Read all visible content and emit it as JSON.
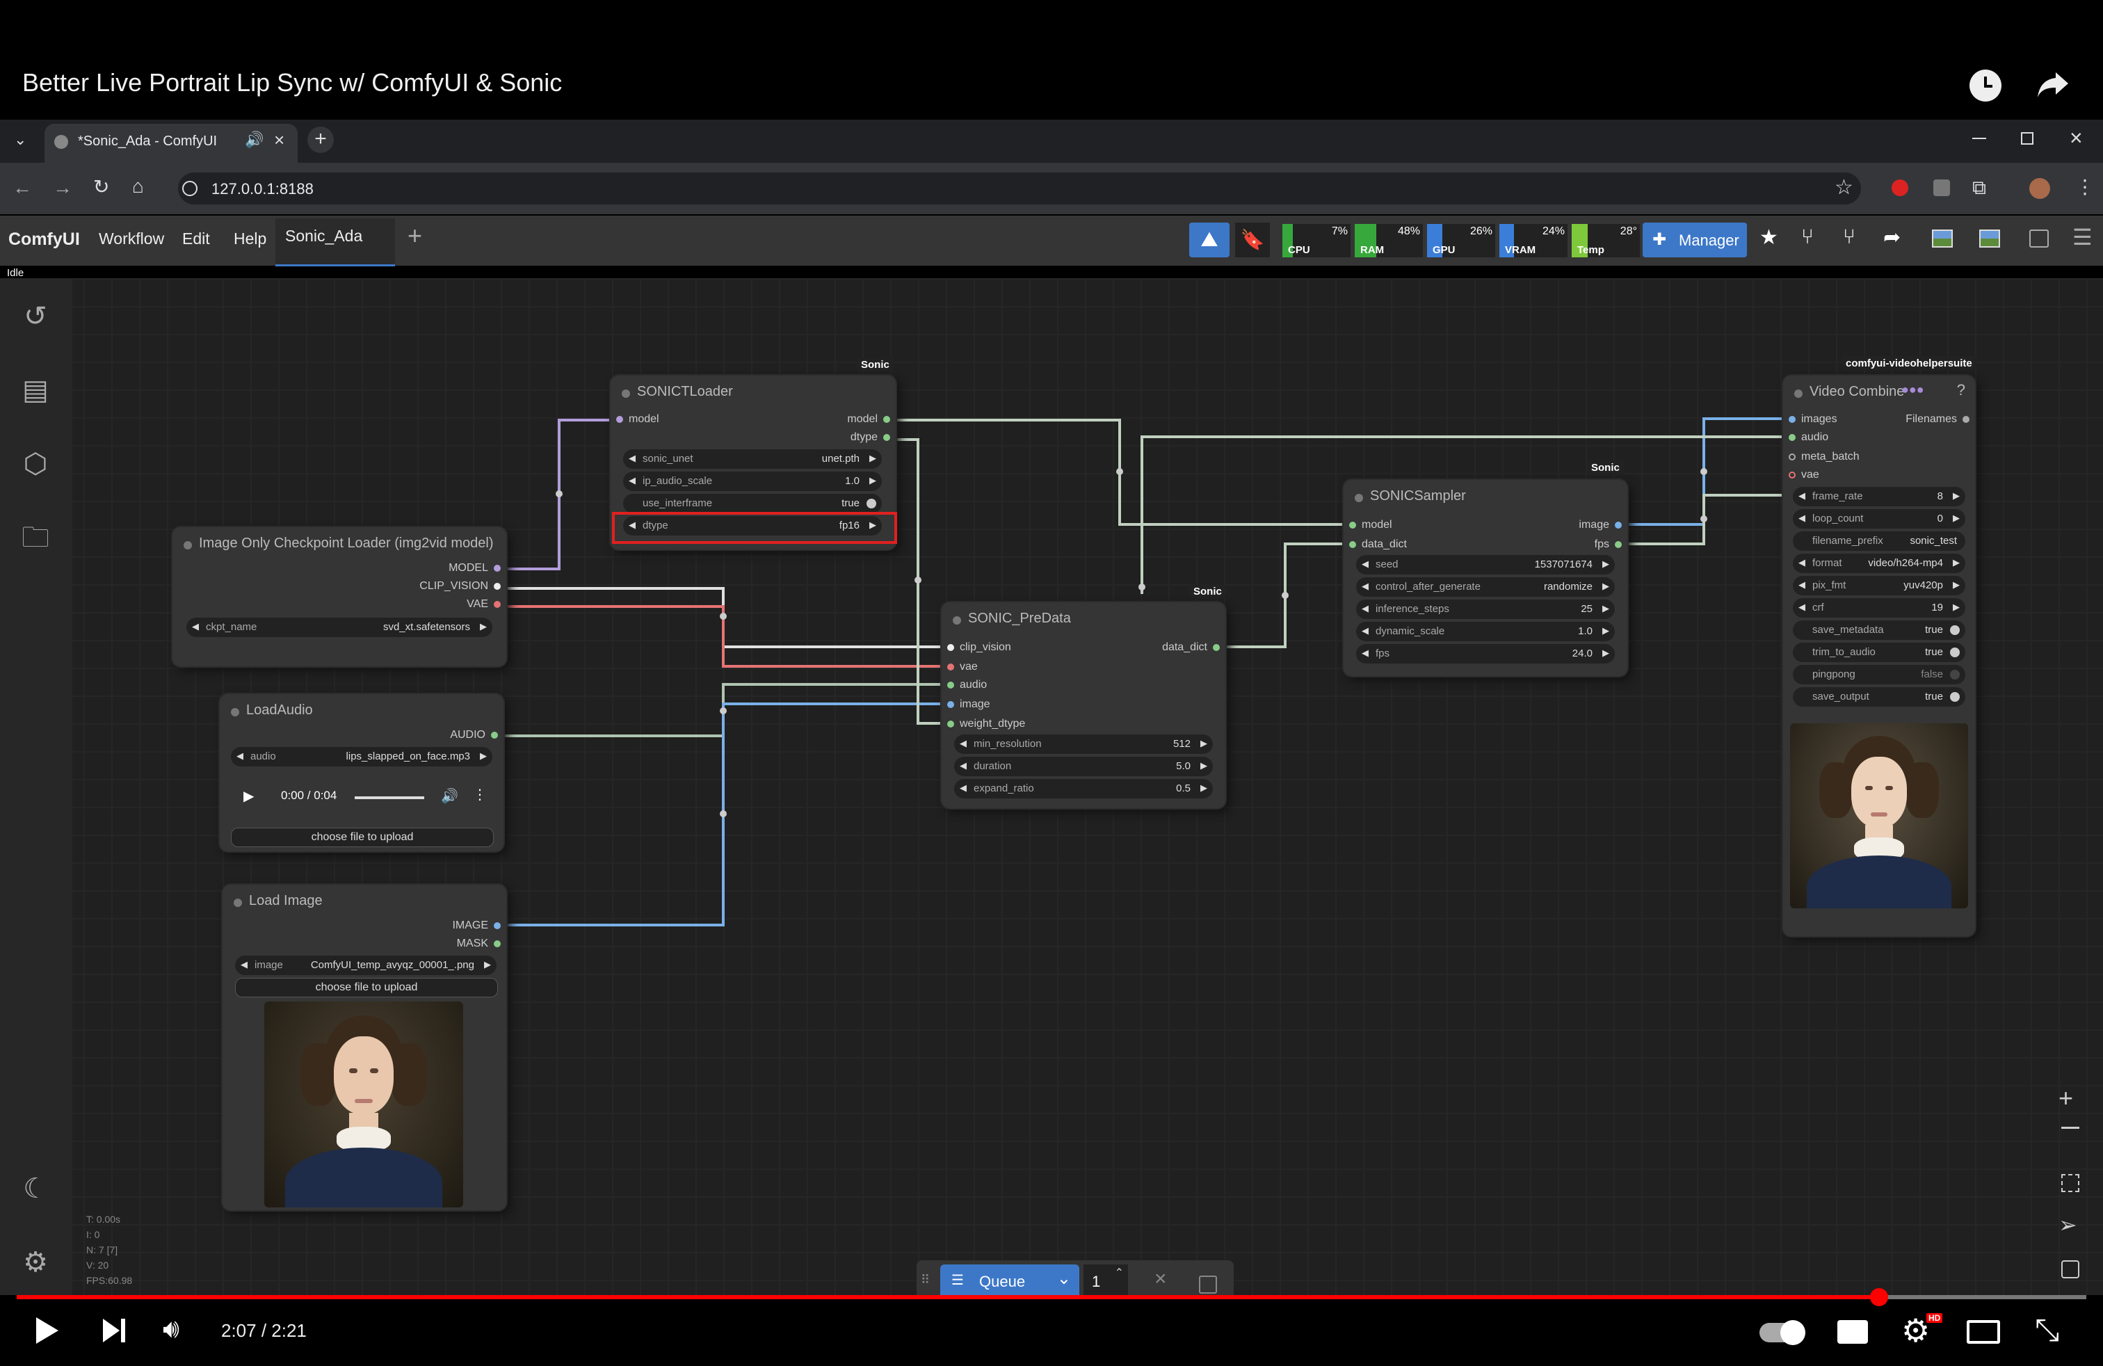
{
  "video": {
    "title": "Better Live Portrait Lip Sync w/ ComfyUI & Sonic",
    "time": "2:07 / 2:21",
    "progress": 0.9,
    "quality_badge": "HD"
  },
  "browser": {
    "tab_title": "*Sonic_Ada - ComfyUI",
    "url": "127.0.0.1:8188"
  },
  "comfy": {
    "logo": "ComfyUI",
    "menu": [
      "Workflow",
      "Edit",
      "Help"
    ],
    "workflow_tab": "Sonic_Ada",
    "status": "Idle",
    "manager_label": "Manager",
    "stats": [
      {
        "label": "CPU",
        "value": "7%",
        "color": "#37a83b",
        "fill": 0.07
      },
      {
        "label": "RAM",
        "value": "48%",
        "color": "#37a83b",
        "fill": 0.48
      },
      {
        "label": "GPU",
        "value": "26%",
        "color": "#3b7ed9",
        "fill": 0.26
      },
      {
        "label": "VRAM",
        "value": "24%",
        "color": "#3b7ed9",
        "fill": 0.24
      },
      {
        "label": "Temp",
        "value": "28°",
        "color": "#7ec83b",
        "fill": 0.28
      }
    ],
    "stats_text": [
      "T: 0.00s",
      "I: 0",
      "N: 7 [7]",
      "V: 20",
      "FPS:60.98"
    ],
    "queue": {
      "label": "Queue",
      "count": "1"
    }
  },
  "nodes": {
    "sonic_loader": {
      "title": "SONICTLoader",
      "tag": "Sonic",
      "inputs": [
        "model"
      ],
      "outputs": [
        "model",
        "dtype"
      ],
      "widgets": [
        {
          "label": "sonic_unet",
          "value": "unet.pth"
        },
        {
          "label": "ip_audio_scale",
          "value": "1.0"
        },
        {
          "label": "use_interframe",
          "value": "true"
        },
        {
          "label": "dtype",
          "value": "fp16"
        }
      ]
    },
    "checkpoint": {
      "title": "Image Only Checkpoint Loader (img2vid model)",
      "outputs": [
        "MODEL",
        "CLIP_VISION",
        "VAE"
      ],
      "widgets": [
        {
          "label": "ckpt_name",
          "value": "svd_xt.safetensors"
        }
      ]
    },
    "load_audio": {
      "title": "LoadAudio",
      "outputs": [
        "AUDIO"
      ],
      "widgets": [
        {
          "label": "audio",
          "value": "lips_slapped_on_face.mp3"
        }
      ],
      "player_time": "0:00 / 0:04",
      "upload_label": "choose file to upload"
    },
    "load_image": {
      "title": "Load Image",
      "outputs": [
        "IMAGE",
        "MASK"
      ],
      "widgets": [
        {
          "label": "image",
          "value": "ComfyUI_temp_avyqz_00001_.png"
        }
      ],
      "upload_label": "choose file to upload"
    },
    "predata": {
      "title": "SONIC_PreData",
      "tag": "Sonic",
      "inputs": [
        "clip_vision",
        "vae",
        "audio",
        "image",
        "weight_dtype"
      ],
      "outputs": [
        "data_dict"
      ],
      "widgets": [
        {
          "label": "min_resolution",
          "value": "512"
        },
        {
          "label": "duration",
          "value": "5.0"
        },
        {
          "label": "expand_ratio",
          "value": "0.5"
        }
      ]
    },
    "sampler": {
      "title": "SONICSampler",
      "tag": "Sonic",
      "inputs": [
        "model",
        "data_dict"
      ],
      "outputs": [
        "image",
        "fps"
      ],
      "widgets": [
        {
          "label": "seed",
          "value": "1537071674"
        },
        {
          "label": "control_after_generate",
          "value": "randomize"
        },
        {
          "label": "inference_steps",
          "value": "25"
        },
        {
          "label": "dynamic_scale",
          "value": "1.0"
        },
        {
          "label": "fps",
          "value": "24.0"
        }
      ]
    },
    "video_combine": {
      "title": "Video Combine",
      "tag": "comfyui-videohelpersuite",
      "inputs": [
        "images",
        "audio",
        "meta_batch",
        "vae"
      ],
      "outputs": [
        "Filenames"
      ],
      "widgets": [
        {
          "label": "frame_rate",
          "value": "8"
        },
        {
          "label": "loop_count",
          "value": "0"
        },
        {
          "label": "filename_prefix",
          "value": "sonic_test"
        },
        {
          "label": "format",
          "value": "video/h264-mp4"
        },
        {
          "label": "pix_fmt",
          "value": "yuv420p"
        },
        {
          "label": "crf",
          "value": "19"
        },
        {
          "label": "save_metadata",
          "value": "true"
        },
        {
          "label": "trim_to_audio",
          "value": "true"
        },
        {
          "label": "pingpong",
          "value": "false"
        },
        {
          "label": "save_output",
          "value": "true"
        }
      ]
    }
  }
}
